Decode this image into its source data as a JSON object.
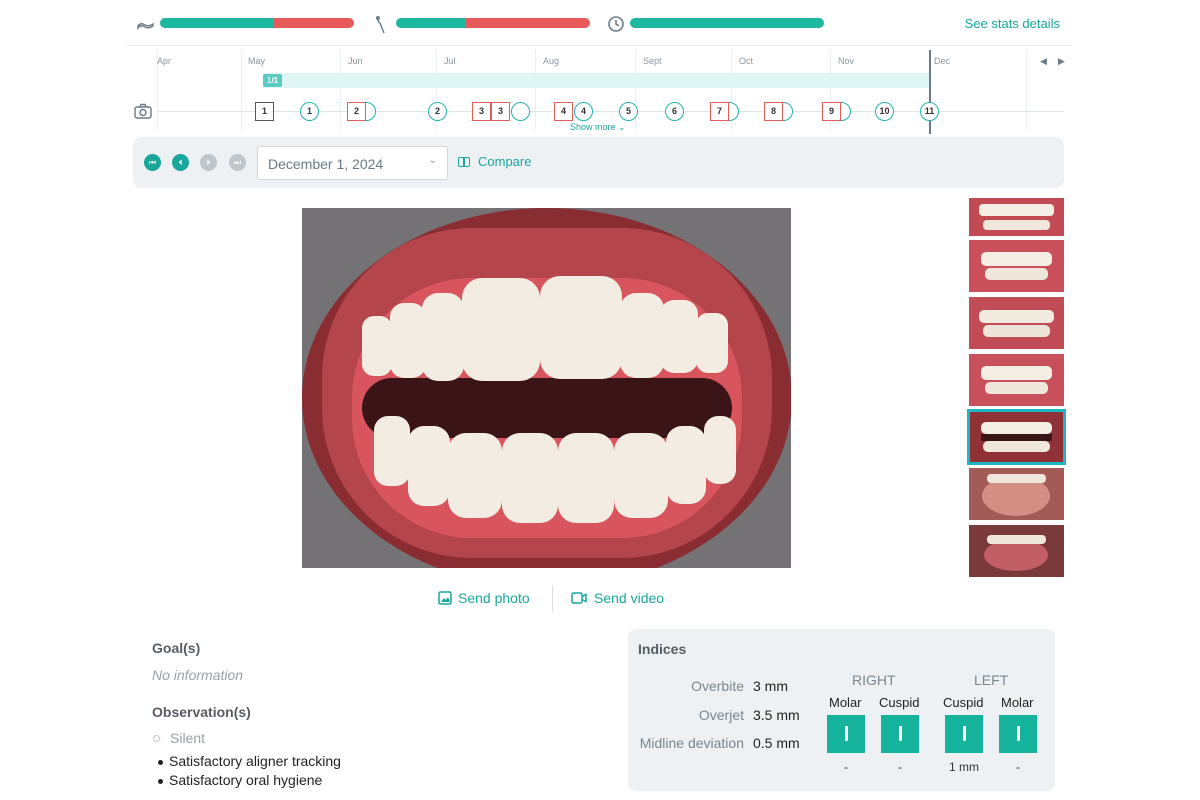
{
  "stats": {
    "link": "See stats details",
    "icons": [
      "aligner-icon",
      "brush-icon",
      "clock-icon"
    ],
    "bars": [
      {
        "name": "aligner-wear",
        "fractions": [
          0.58,
          0.42
        ]
      },
      {
        "name": "hygiene",
        "fractions": [
          0.36,
          0.64
        ]
      },
      {
        "name": "time",
        "fractions": [
          1.0,
          0.0
        ]
      }
    ],
    "colors": {
      "good": "#1db8a1",
      "bad": "#e85a5a"
    }
  },
  "timeline": {
    "months": [
      "Apr",
      "May",
      "Jun",
      "Jul",
      "Aug",
      "Sept",
      "Oct",
      "Nov",
      "Dec"
    ],
    "range_tag": "1/1",
    "show_more": "Show more",
    "markers": {
      "squares": [
        "1",
        "2",
        "3",
        "3",
        "4",
        "7",
        "8",
        "9"
      ],
      "circles": [
        "1",
        "2",
        "4",
        "5",
        "6",
        "10",
        "11"
      ]
    }
  },
  "controls": {
    "date": "December 1, 2024",
    "compare": "Compare"
  },
  "thumbnails": {
    "count": 7,
    "selected_index": 4
  },
  "send": {
    "photo": "Send photo",
    "video": "Send video"
  },
  "goals": {
    "title": "Goal(s)",
    "empty": "No information"
  },
  "observations": {
    "title": "Observation(s)",
    "status": "Silent",
    "items": [
      "Satisfactory aligner tracking",
      "Satisfactory oral hygiene"
    ]
  },
  "indices": {
    "title": "Indices",
    "rows": [
      {
        "label": "Overbite",
        "value": "3 mm"
      },
      {
        "label": "Overjet",
        "value": "3.5 mm"
      },
      {
        "label": "Midline deviation",
        "value": "0.5 mm"
      }
    ],
    "right": {
      "title": "RIGHT",
      "cols": [
        {
          "name": "Molar",
          "value": "-"
        },
        {
          "name": "Cuspid",
          "value": "-"
        }
      ]
    },
    "left": {
      "title": "LEFT",
      "cols": [
        {
          "name": "Cuspid",
          "value": "1 mm"
        },
        {
          "name": "Molar",
          "value": "-"
        }
      ]
    }
  }
}
